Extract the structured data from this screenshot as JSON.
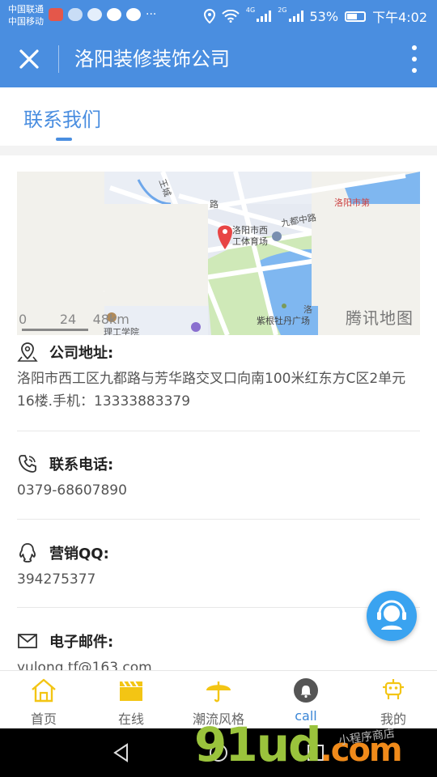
{
  "status_bar": {
    "carrier_1": "中国联通",
    "carrier_2": "中国移动",
    "more": "···",
    "network_1": "4G",
    "network_2": "2G",
    "battery": "53%",
    "time": "下午4:02"
  },
  "app_bar": {
    "title": "洛阳装修装饰公司"
  },
  "tab": {
    "label": "联系我们"
  },
  "map": {
    "labels": {
      "venue": "洛阳市西工体育场",
      "road": "九都中路",
      "street_1": "路",
      "street_2": "王城",
      "park": "紫根牡丹广场",
      "school": "理工学院",
      "top_right": "洛阳市第",
      "area": "洛"
    },
    "scale_text": "0        24    48km",
    "watermark": "腾讯地图"
  },
  "contact": {
    "address_label": "公司地址:",
    "address_value": "洛阳市西工区九都路与芳华路交叉口向南100米红东方C区2单元16楼.手机：13333883379",
    "phone_label": "联系电话:",
    "phone_value": "0379-68607890",
    "qq_label": "营销QQ:",
    "qq_value": "394275377",
    "email_label": "电子邮件:",
    "email_value": "yulong.tf@163.com"
  },
  "bottom_nav": [
    {
      "label": "首页",
      "icon": "home-icon"
    },
    {
      "label": "在线",
      "icon": "clapperboard-icon"
    },
    {
      "label": "潮流风格",
      "icon": "umbrella-icon"
    },
    {
      "label": "call",
      "icon": "bell-icon"
    },
    {
      "label": "我的",
      "icon": "robot-icon"
    }
  ],
  "watermark_logo": {
    "main": "91ud",
    "suffix": ".com",
    "tagline": "小程序商店"
  },
  "colors": {
    "primary": "#4a8ee0",
    "nav_icon_yellow": "#f3c514",
    "fab": "#3aa3f0"
  }
}
